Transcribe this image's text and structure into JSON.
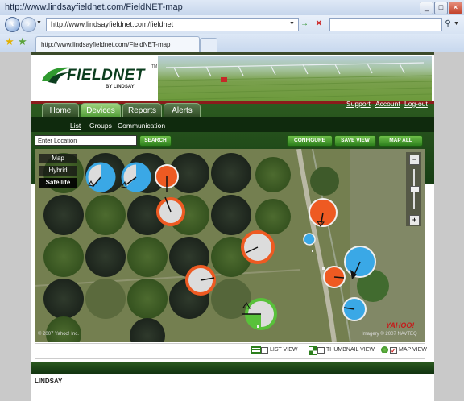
{
  "window": {
    "title": "http://www.lindsayfieldnet.com/FieldNET-map"
  },
  "browser": {
    "address": "http://www.lindsayfieldnet.com/fieldnet",
    "tab_title": "http://www.lindsayfieldnet.com/FieldNET-map",
    "search_placeholder": ""
  },
  "brand": {
    "name": "FIELDNET",
    "sub": "BY LINDSAY",
    "tm": "TM"
  },
  "nav": {
    "tabs": [
      {
        "label": "Home",
        "active": false
      },
      {
        "label": "Devices",
        "active": true
      },
      {
        "label": "Reports",
        "active": false
      },
      {
        "label": "Alerts",
        "active": false
      }
    ],
    "links": [
      "Support",
      "Account",
      "Log-out"
    ],
    "subnav": [
      "List",
      "Groups",
      "Communication"
    ]
  },
  "toolbar": {
    "location_value": "Enter Location",
    "search_label": "SEARCH",
    "configure_label": "CONFIGURE",
    "save_view_label": "SAVE VIEW",
    "map_all_label": "MAP ALL"
  },
  "map": {
    "types": [
      {
        "label": "Map",
        "active": false
      },
      {
        "label": "Hybrid",
        "active": false
      },
      {
        "label": "Satellite",
        "active": true
      }
    ],
    "copyright_left": "© 2007 Yahoo! Inc.",
    "copyright_right": "Imagery © 2007 NAVTEQ",
    "watermark": "YAHOO!",
    "zoom_in": "+",
    "zoom_out": "−",
    "status_colors": {
      "ok": "#3aa8e6",
      "alert": "#ee5a22",
      "stopped": "#cfcfcf",
      "running": "#58c13a"
    }
  },
  "views": {
    "list": "LIST VIEW",
    "thumbnail": "THUMBNAIL VIEW",
    "map": "MAP VIEW",
    "selected": "map"
  },
  "footer": {
    "logo": "LINDSAY"
  }
}
